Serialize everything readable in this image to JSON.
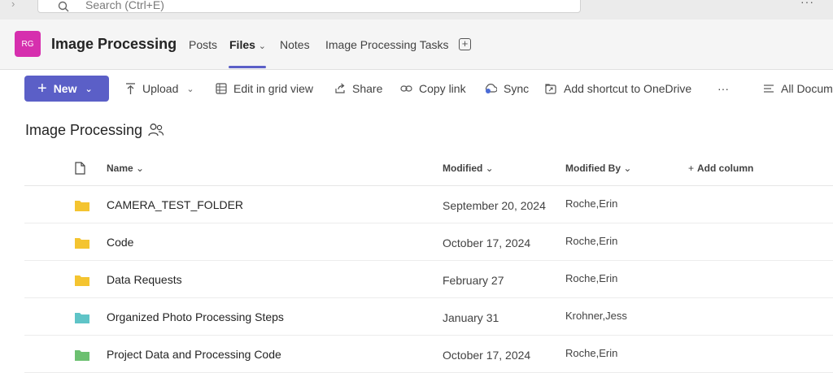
{
  "search": {
    "placeholder": "Search (Ctrl+E)"
  },
  "team": {
    "initials": "RG",
    "name": "Image Processing"
  },
  "tabs": [
    {
      "label": "Posts"
    },
    {
      "label": "Files"
    },
    {
      "label": "Notes"
    },
    {
      "label": "Image Processing Tasks"
    }
  ],
  "commands": {
    "new_label": "New",
    "upload": "Upload",
    "edit_grid": "Edit in grid view",
    "share": "Share",
    "copy_link": "Copy link",
    "sync": "Sync",
    "add_shortcut": "Add shortcut to OneDrive",
    "more": "···",
    "view": "All Docum"
  },
  "library": {
    "title": "Image Processing"
  },
  "columns": {
    "name": "Name",
    "modified": "Modified",
    "modified_by": "Modified By",
    "add_column": "Add column"
  },
  "rows": [
    {
      "name": "CAMERA_TEST_FOLDER",
      "modified": "September 20, 2024",
      "modified_by": "Roche,Erin",
      "folder_color": "#f4c430"
    },
    {
      "name": "Code",
      "modified": "October 17, 2024",
      "modified_by": "Roche,Erin",
      "folder_color": "#f4c430"
    },
    {
      "name": "Data Requests",
      "modified": "February 27",
      "modified_by": "Roche,Erin",
      "folder_color": "#f4c430"
    },
    {
      "name": "Organized Photo Processing Steps",
      "modified": "January 31",
      "modified_by": "Krohner,Jess",
      "folder_color": "#5fc4c7"
    },
    {
      "name": "Project Data and Processing Code",
      "modified": "October 17, 2024",
      "modified_by": "Roche,Erin",
      "folder_color": "#6cc070"
    }
  ],
  "colors": {
    "accent": "#5b5fc7",
    "avatar": "#d62fae"
  }
}
